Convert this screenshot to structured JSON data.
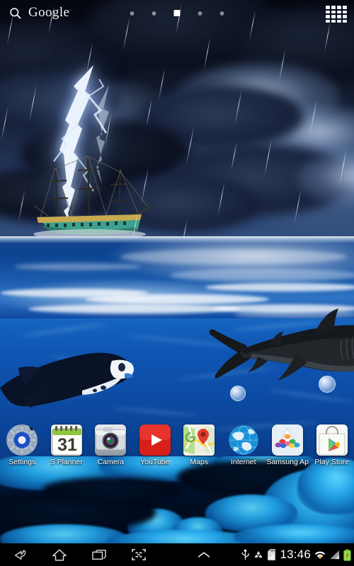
{
  "wallpaper": {
    "name": "Stormy Ocean Shark Live Wallpaper",
    "scene_description": "Thunderstorm over ocean with sailing ship, lightning and rain above waterline; underwater scene with shark, manta ray, bubbles and coral reef below",
    "colors": {
      "sky_dark": "#05070e",
      "sky_light": "#32507f",
      "lightning": "#e8f2ff",
      "sea_surface": "#0b3c86",
      "underwater_top": "#1565c0",
      "underwater_bottom": "#01132e",
      "coral_cyan": "#5fd8ff",
      "ship_hull": "#3a9b8e"
    }
  },
  "topbar": {
    "search": {
      "icon": "search-icon",
      "label": "Google"
    },
    "page_dots": [
      {
        "index": 1,
        "active": false
      },
      {
        "index": 2,
        "active": false
      },
      {
        "index": 3,
        "active": true
      },
      {
        "index": 4,
        "active": false
      },
      {
        "index": 5,
        "active": false
      }
    ],
    "apps_grid": {
      "icon": "apps-grid-icon",
      "rows": 4,
      "cols": 4
    }
  },
  "app_row": [
    {
      "label": "Settings",
      "icon": "settings-gear-icon"
    },
    {
      "label": "S Planner",
      "icon": "calendar-icon",
      "badge": "31"
    },
    {
      "label": "Camera",
      "icon": "camera-icon"
    },
    {
      "label": "YouTube",
      "icon": "youtube-play-icon"
    },
    {
      "label": "Maps",
      "icon": "maps-pin-icon"
    },
    {
      "label": "Internet",
      "icon": "globe-icon"
    },
    {
      "label": "Samsung Ap",
      "icon": "samsung-apps-icon"
    },
    {
      "label": "Play Store",
      "icon": "play-store-bag-icon"
    }
  ],
  "navbar": {
    "buttons": [
      {
        "name": "back-button",
        "icon": "back-arrow-icon"
      },
      {
        "name": "home-button",
        "icon": "home-icon"
      },
      {
        "name": "recents-button",
        "icon": "recent-apps-icon"
      },
      {
        "name": "screenshot-button",
        "icon": "screen-capture-icon"
      },
      {
        "name": "expand-button",
        "icon": "chevron-up-icon"
      }
    ],
    "status": {
      "usb_icon": "usb-icon",
      "recycle_icon": "recycle-icon",
      "sdcard_icon": "sd-card-icon",
      "clock": "13:46",
      "wifi_icon": "wifi-download-icon",
      "signal_icon": "signal-bars-icon",
      "battery_icon": "battery-charging-icon"
    }
  }
}
